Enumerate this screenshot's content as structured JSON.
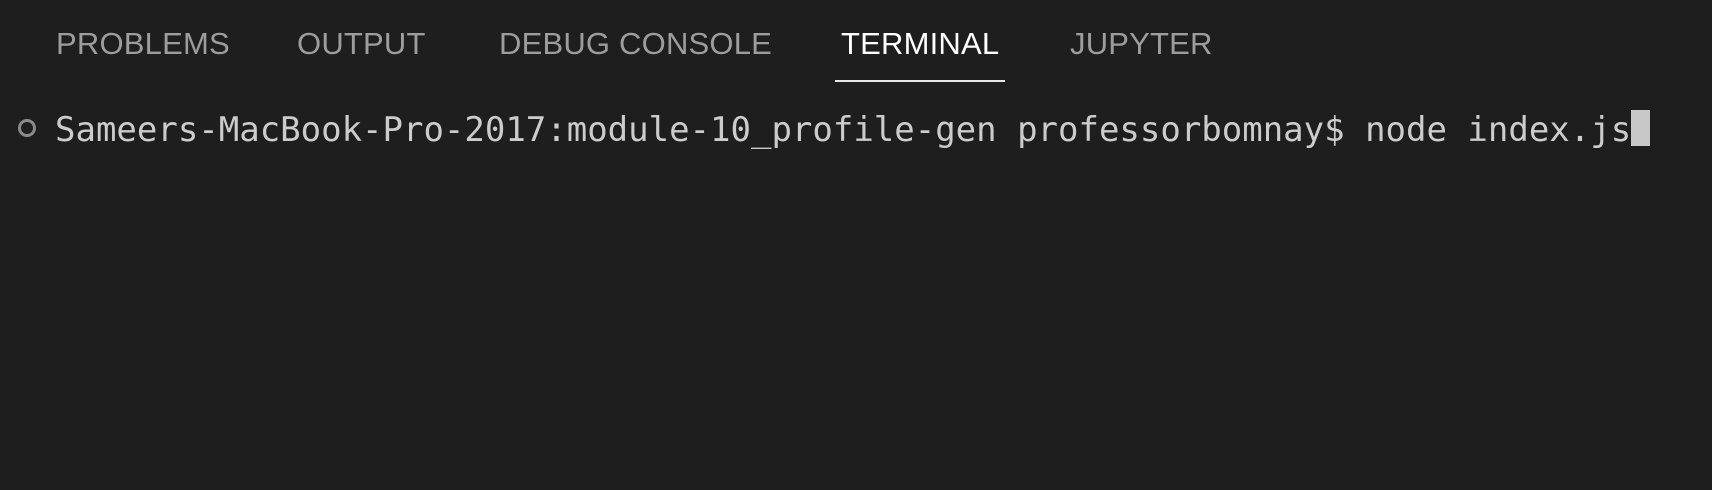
{
  "panel": {
    "tabs": [
      {
        "label": "PROBLEMS",
        "active": false
      },
      {
        "label": "OUTPUT",
        "active": false
      },
      {
        "label": "DEBUG CONSOLE",
        "active": false
      },
      {
        "label": "TERMINAL",
        "active": true
      },
      {
        "label": "JUPYTER",
        "active": false
      }
    ]
  },
  "terminal": {
    "prompt": "Sameers-MacBook-Pro-2017:module-10_profile-gen professorbomnay$",
    "command": "node index.js"
  },
  "colors": {
    "background": "#1e1e1e",
    "tab_inactive": "#9d9d9d",
    "tab_active": "#ffffff",
    "text": "#cccccc"
  },
  "icons": {
    "command_decoration": "circle-outline-icon",
    "cursor": "block-cursor-icon"
  }
}
